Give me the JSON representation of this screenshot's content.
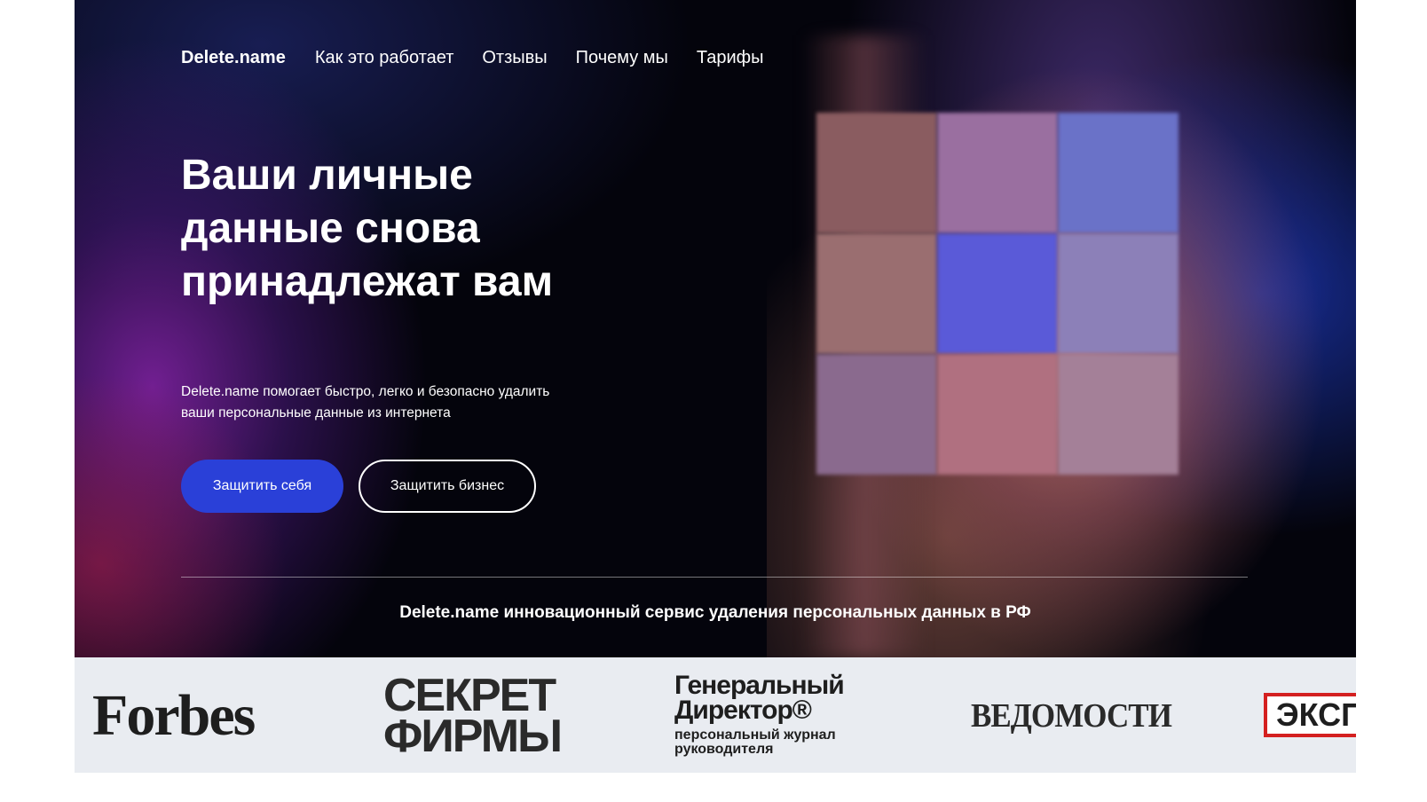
{
  "nav": {
    "logo": "Delete.name",
    "links": [
      "Как это работает",
      "Отзывы",
      "Почему мы",
      "Тарифы"
    ]
  },
  "hero": {
    "headline": "Ваши личные данные снова принадлежат вам",
    "subtitle": "Delete.name помогает быстро, легко и безопасно удалить ваши персональные данные из интернета",
    "primary_button": "Защитить себя",
    "secondary_button": "Защитить бизнес",
    "tagline": "Delete.name инновационный сервис удаления персональных данных в РФ"
  },
  "press": {
    "forbes": "Forbes",
    "sekret_line1": "СЕКРЕТ",
    "sekret_line2": "ФИРМЫ",
    "gd_line1": "Генеральный",
    "gd_line2": "Директор®",
    "gd_sub1": "персональный журнал",
    "gd_sub2": "руководителя",
    "vedomosti": "ВЕДОМОСТИ",
    "ekspert": "ЭКСП"
  },
  "colors": {
    "accent": "#2a40d8",
    "hero_bg": "#04040c",
    "press_bg": "#e9ecf1",
    "ekspert_red": "#d42020"
  }
}
